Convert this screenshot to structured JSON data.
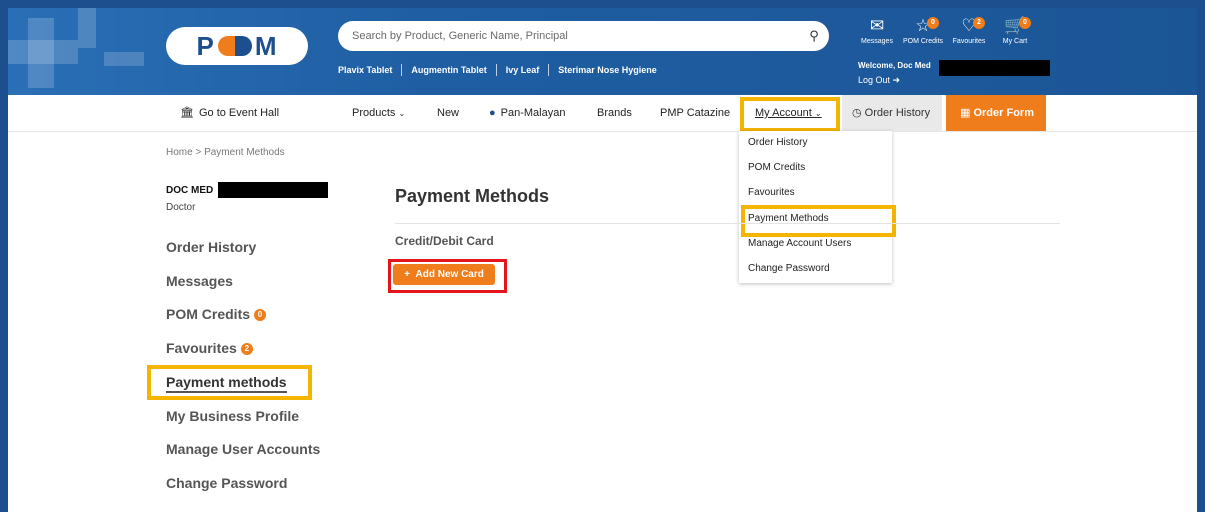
{
  "header": {
    "logo_text": "POM",
    "search": {
      "placeholder": "Search by Product, Generic Name, Principal",
      "icon": "search-icon"
    },
    "quick_links": [
      "Plavix Tablet",
      "Augmentin Tablet",
      "Ivy Leaf",
      "Sterimar Nose Hygiene"
    ],
    "icons": [
      {
        "label": "Messages",
        "icon": "inbox-icon",
        "count": ""
      },
      {
        "label": "POM Credits",
        "icon": "star-icon",
        "count": "0"
      },
      {
        "label": "Favourites",
        "icon": "heart-icon",
        "count": "2"
      },
      {
        "label": "My Cart",
        "icon": "cart-icon",
        "count": "0"
      }
    ],
    "welcome": "Welcome, Doc Med",
    "logout": "Log Out"
  },
  "nav": {
    "event_hall": "Go to Event Hall",
    "products": "Products",
    "new": "New",
    "pan_malayan": "Pan-Malayan",
    "brands": "Brands",
    "catazine": "PMP Catazine",
    "my_account": "My Account",
    "order_history": "Order History",
    "order_form": "Order Form"
  },
  "dropdown": [
    "Order History",
    "POM Credits",
    "Favourites",
    "Payment Methods",
    "Manage Account Users",
    "Change Password"
  ],
  "breadcrumb": "Home > Payment Methods",
  "user": {
    "name": "DOC MED",
    "role": "Doctor"
  },
  "sidebar": [
    {
      "label": "Order History",
      "badge": ""
    },
    {
      "label": "Messages",
      "badge": ""
    },
    {
      "label": "POM Credits",
      "badge": "0"
    },
    {
      "label": "Favourites",
      "badge": "2"
    },
    {
      "label": "Payment methods",
      "badge": ""
    },
    {
      "label": "My Business Profile",
      "badge": ""
    },
    {
      "label": "Manage User Accounts",
      "badge": ""
    },
    {
      "label": "Change Password",
      "badge": ""
    }
  ],
  "main": {
    "title": "Payment Methods",
    "section_label": "Credit/Debit Card",
    "add_card": "Add New Card"
  },
  "colors": {
    "brand_blue": "#1d4f8f",
    "accent_orange": "#f07d1b",
    "highlight_yellow": "#f5b400",
    "highlight_red": "#e3151b"
  }
}
